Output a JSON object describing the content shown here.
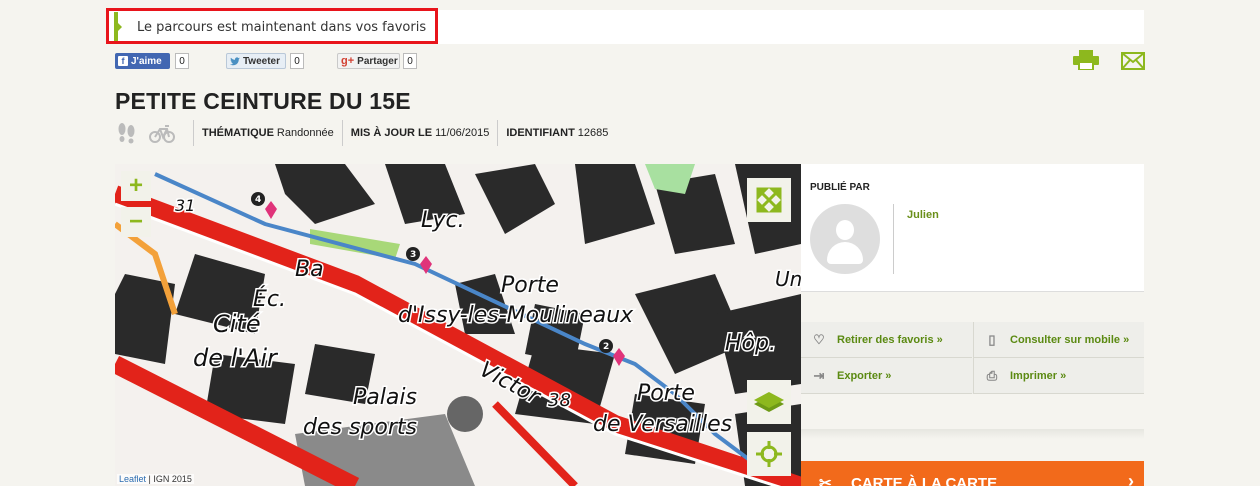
{
  "notification": {
    "message": "Le parcours est maintenant dans vos favoris"
  },
  "social": {
    "facebook": {
      "label": "J'aime",
      "count": "0"
    },
    "twitter": {
      "label": "Tweeter",
      "count": "0"
    },
    "google": {
      "label": "Partager",
      "count": "0"
    }
  },
  "route": {
    "title": "PETITE CEINTURE DU 15E",
    "thematique_label": "THÉMATIQUE",
    "thematique_value": "Randonnée",
    "updated_label": "MIS À JOUR LE",
    "updated_value": "11/06/2015",
    "id_label": "IDENTIFIANT",
    "id_value": "12685"
  },
  "map": {
    "labels": [
      "31",
      "Lyc.",
      "Porte",
      "d'Issy-les-Moulineaux",
      "Éc.",
      "Cité",
      "de l'Air",
      "Ba",
      "Victor",
      "38",
      "Palais",
      "des sports",
      "Porte",
      "de Versailles",
      "Hôp.",
      "Un"
    ],
    "markers": [
      "4",
      "3",
      "2"
    ],
    "attribution_link": "Leaflet",
    "attribution_text": "| IGN 2015"
  },
  "sidebar": {
    "published_by_label": "PUBLIÉ PAR",
    "author": "Julien",
    "actions": [
      {
        "label": "Retirer des favoris »",
        "icon": "heart-icon"
      },
      {
        "label": "Consulter sur mobile »",
        "icon": "mobile-icon"
      },
      {
        "label": "Exporter »",
        "icon": "export-icon"
      },
      {
        "label": "Imprimer »",
        "icon": "print-icon"
      }
    ],
    "orange_banner": "CARTE À LA CARTE"
  },
  "colors": {
    "accent_green": "#8db81e",
    "link_green": "#5b8a12",
    "alert_red": "#e8141b",
    "orange": "#f26a1b"
  }
}
